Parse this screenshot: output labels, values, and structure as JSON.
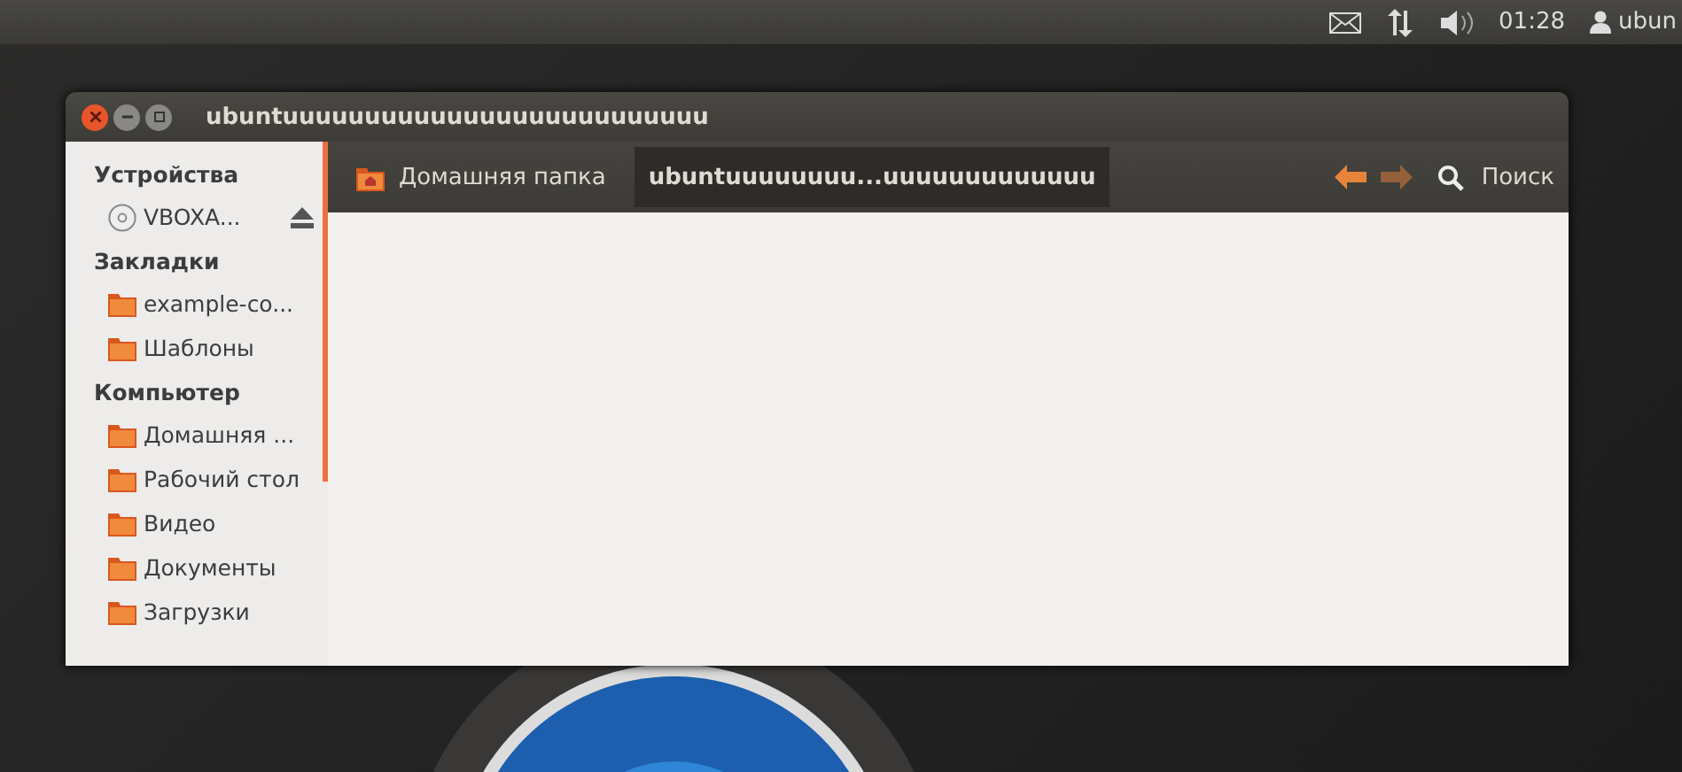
{
  "top_panel": {
    "clock": "01:28",
    "user": "ubun"
  },
  "window": {
    "title": "ubuntuuuuuuuuuuuuuuuuuuuuuuuuuu"
  },
  "sidebar": {
    "sections": [
      {
        "title": "Устройства",
        "kind": "devices",
        "items": [
          {
            "label": "VBOXA..."
          }
        ]
      },
      {
        "title": "Закладки",
        "kind": "places",
        "items": [
          {
            "label": "example-co..."
          },
          {
            "label": "Шаблоны"
          }
        ]
      },
      {
        "title": "Компьютер",
        "kind": "places",
        "items": [
          {
            "label": "Домашняя ..."
          },
          {
            "label": "Рабочий стол"
          },
          {
            "label": "Видео"
          },
          {
            "label": "Документы"
          },
          {
            "label": "Загрузки"
          }
        ]
      }
    ]
  },
  "toolbar": {
    "path": [
      {
        "label": "Домашняя папка",
        "selected": false
      },
      {
        "label": "ubuntuuuuuuuu...uuuuuuuuuuuuu",
        "selected": true
      }
    ],
    "back": {
      "disabled": false
    },
    "forward": {
      "disabled": true
    },
    "search": "Поиск"
  }
}
